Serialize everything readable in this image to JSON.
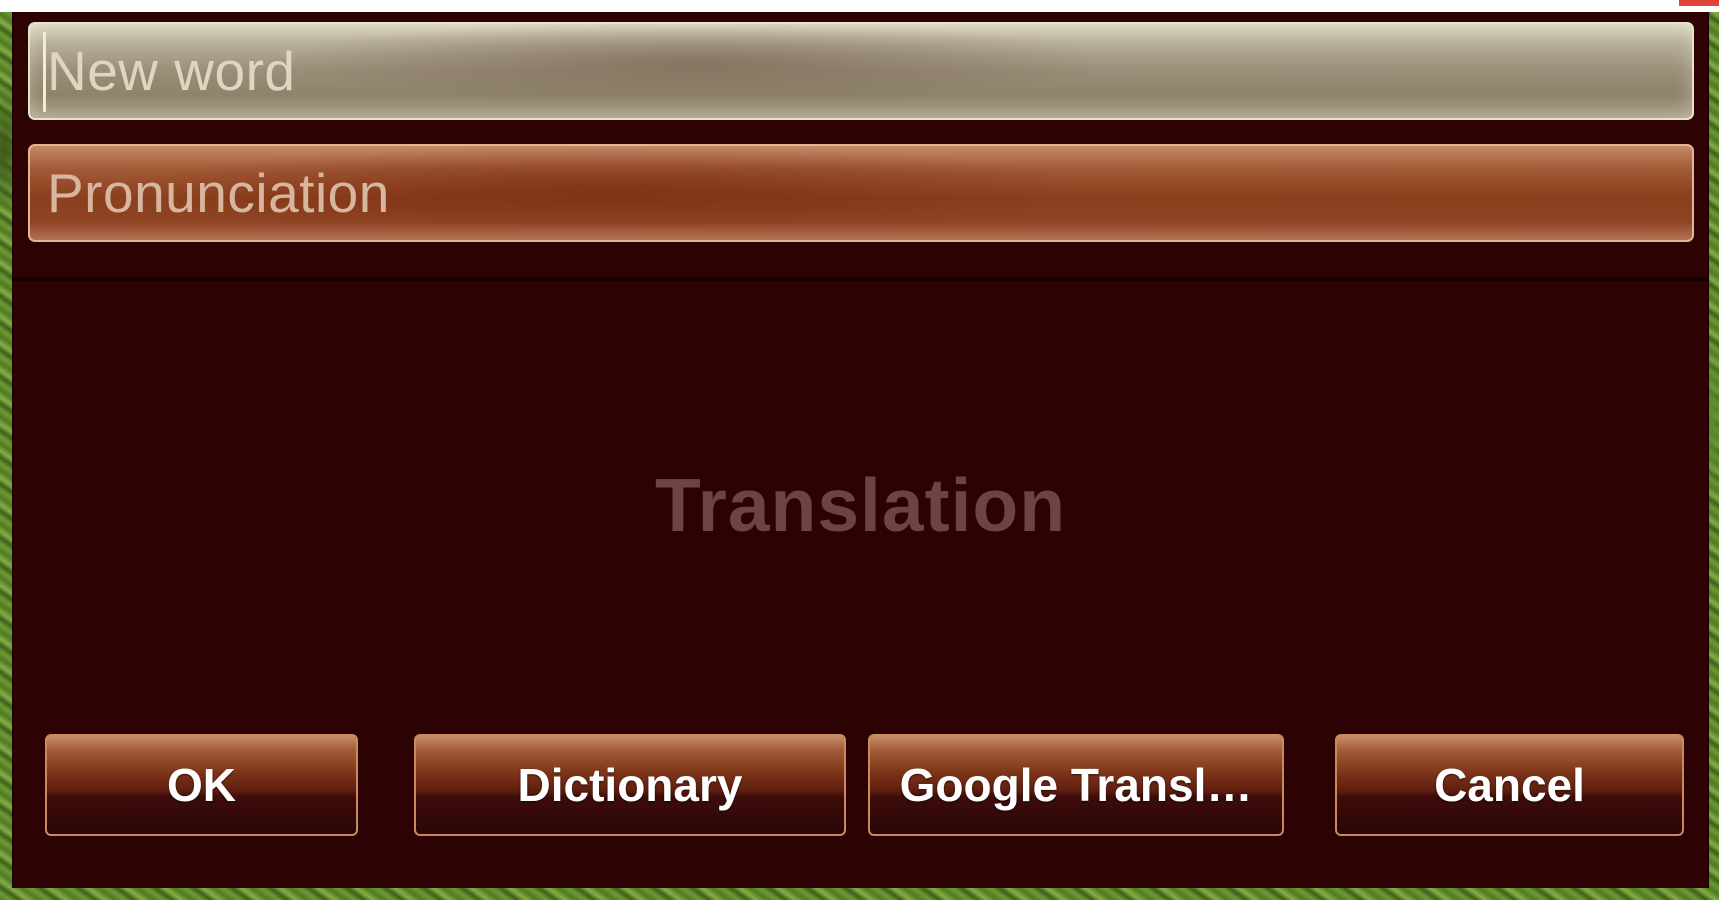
{
  "fields": {
    "new_word_placeholder": "New word",
    "pronunciation_placeholder": "Pronunciation",
    "translation_placeholder": "Translation"
  },
  "buttons": {
    "ok_label": "OK",
    "dictionary_label": "Dictionary",
    "google_translate_label": "Google Transl…",
    "cancel_label": "Cancel"
  },
  "colors": {
    "dialog_background": "#2c0203",
    "button_border": "#c88a5c",
    "pronunciation_field": "#8a3f1d",
    "word_field": "#9a8e78"
  }
}
